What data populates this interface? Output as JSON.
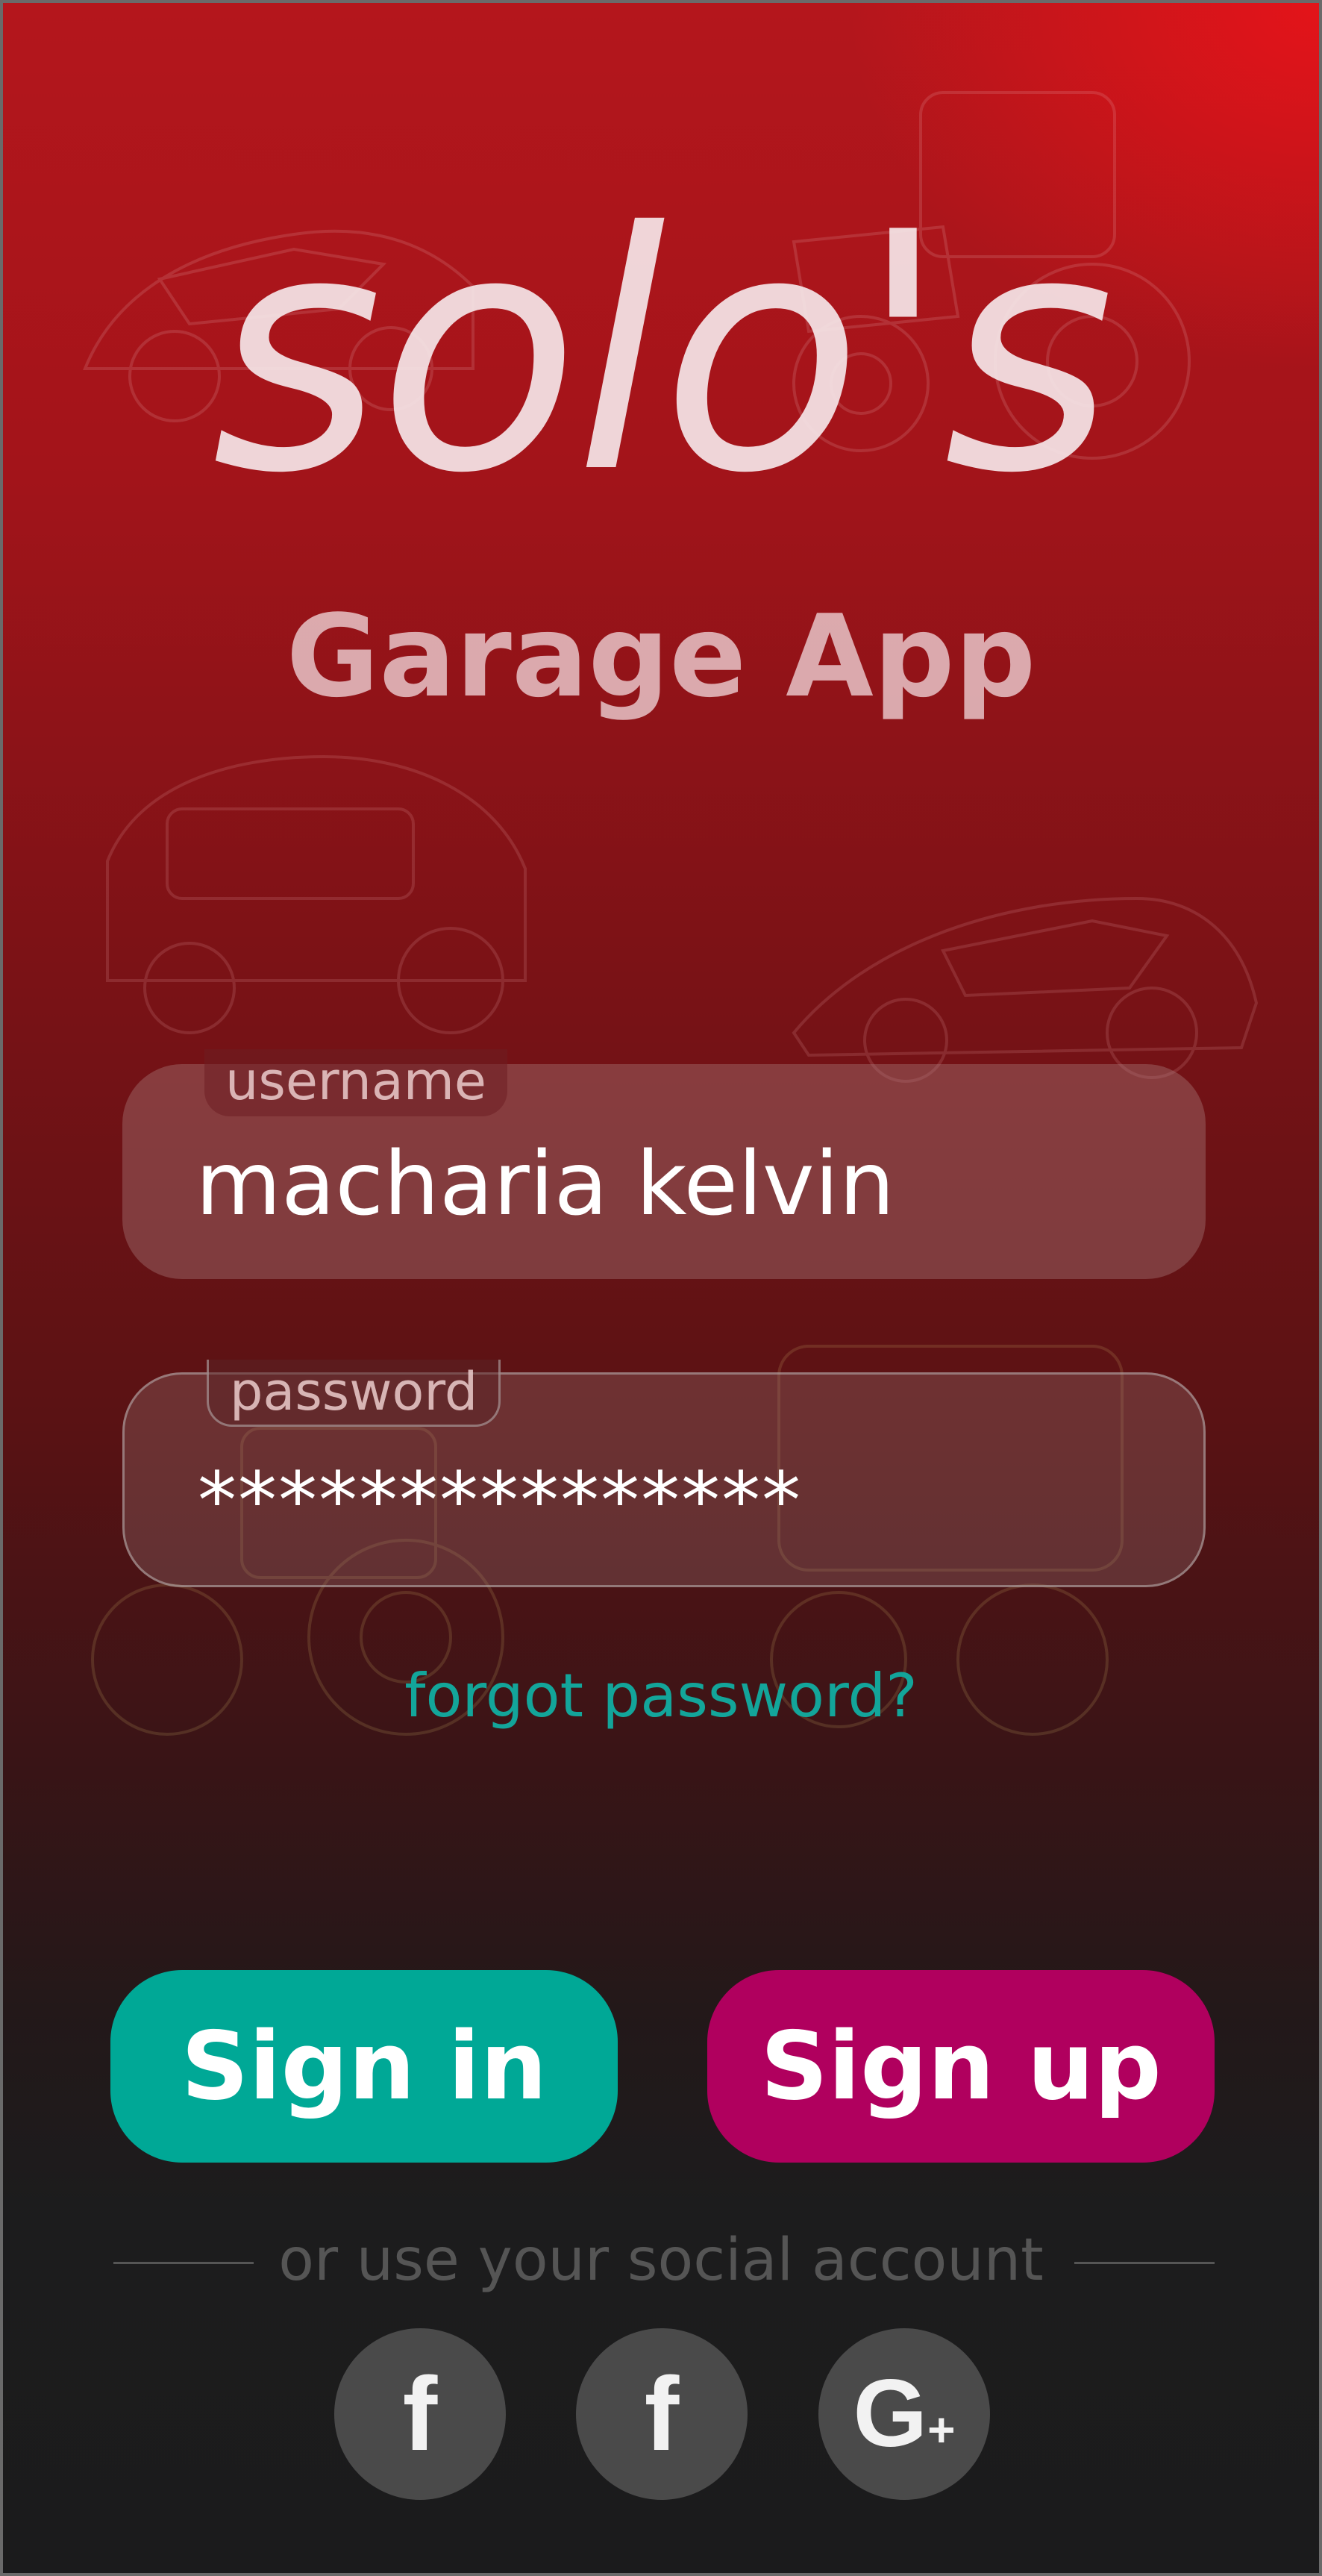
{
  "app": {
    "title": "solo's",
    "subtitle": "Garage App"
  },
  "form": {
    "username": {
      "label": "username",
      "value": "macharia kelvin"
    },
    "password": {
      "label": "password",
      "value": "***************"
    },
    "forgot_link": "forgot password?"
  },
  "buttons": {
    "signin": "Sign in",
    "signup": "Sign up"
  },
  "social": {
    "divider_text": "or use your social account",
    "items": [
      {
        "icon": "facebook-icon",
        "glyph": "f"
      },
      {
        "icon": "facebook-icon",
        "glyph": "f"
      },
      {
        "icon": "google-plus-icon",
        "glyph": "G",
        "suffix": "+"
      }
    ]
  },
  "colors": {
    "signin": "#00a896",
    "signup": "#b0005e",
    "link": "#13a59a",
    "background_top": "#b4161c",
    "background_bottom": "#1b1b1c"
  }
}
